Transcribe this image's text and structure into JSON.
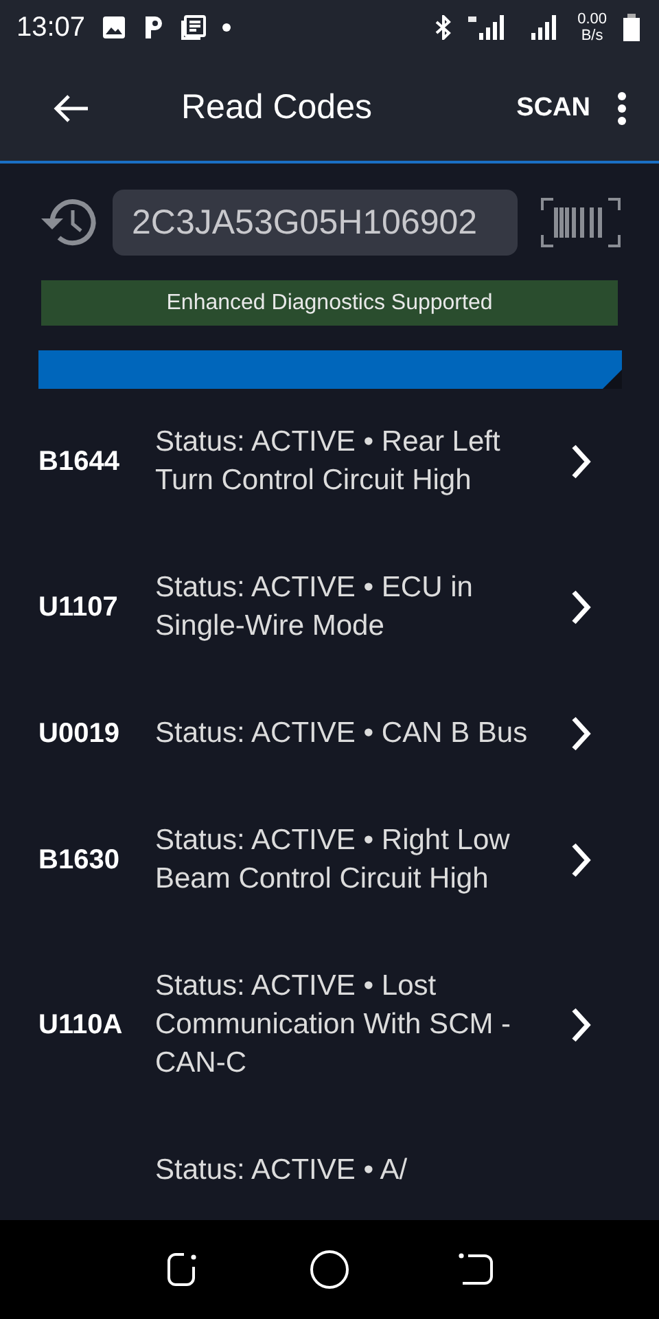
{
  "status_bar": {
    "time": "13:07",
    "speed_value": "0.00",
    "speed_unit": "B/s"
  },
  "app_bar": {
    "title": "Read Codes",
    "action": "SCAN"
  },
  "vin": {
    "value": "2C3JA53G05H106902"
  },
  "banner": "Enhanced Diagnostics Supported",
  "progress": {
    "level": 1
  },
  "codes": [
    {
      "code": "B1644",
      "description": "Status: ACTIVE • Rear Left Turn Control Circuit High"
    },
    {
      "code": "U1107",
      "description": "Status: ACTIVE • ECU in Single-Wire Mode"
    },
    {
      "code": "U0019",
      "description": "Status: ACTIVE • CAN B Bus"
    },
    {
      "code": "B1630",
      "description": "Status: ACTIVE • Right Low Beam Control Circuit High"
    },
    {
      "code": "U110A",
      "description": "Status: ACTIVE • Lost Communication With SCM - CAN-C"
    },
    {
      "description": "Status: ACTIVE • A/"
    }
  ]
}
